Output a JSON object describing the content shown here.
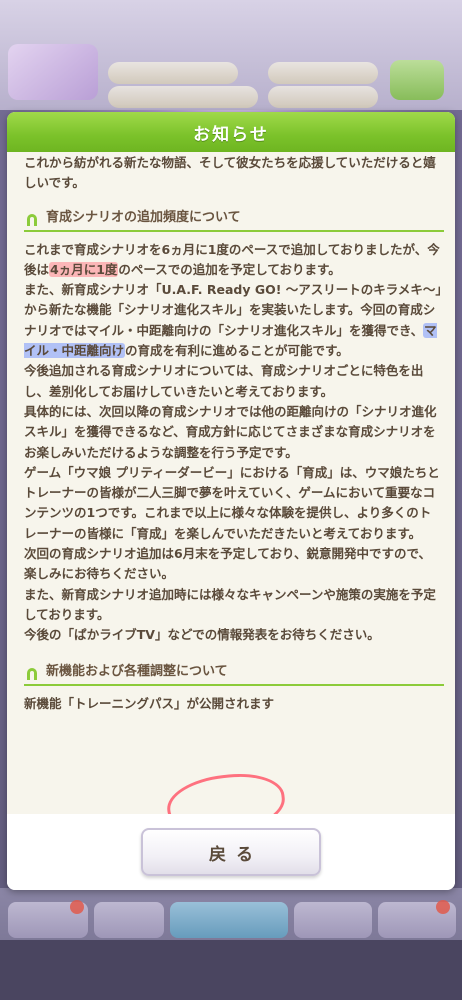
{
  "dialog": {
    "title": "お知らせ",
    "back_label": "戻る"
  },
  "content": {
    "intro": "これから紡がれる新たな物語、そして彼女たちを応援していただけると嬉しいです。",
    "section1": {
      "heading": "育成シナリオの追加頻度について",
      "p1_a": "これまで育成シナリオを6ヵ月に1度のペースで追加しておりましたが、今後は",
      "p1_hl": "4ヵ月に1度",
      "p1_b": "のペースでの追加を予定しております。",
      "p2_a": "また、新育成シナリオ「U.A.F. Ready GO! ～アスリートのキラメキ～」から新たな機能「シナリオ進化スキル」を実装いたします。今回の育成シナリオではマイル・中距離向けの「シナリオ進化スキル」を獲得でき、",
      "p2_hl": "マイル・中距離向け",
      "p2_b": "の育成を有利に進めることが可能です。",
      "p3": "今後追加される育成シナリオについては、育成シナリオごとに特色を出し、差別化してお届けしていきたいと考えております。",
      "p4": "具体的には、次回以降の育成シナリオでは他の距離向けの「シナリオ進化スキル」を獲得できるなど、育成方針に応じてさまざまな育成シナリオをお楽しみいただけるような調整を行う予定です。",
      "p5": "ゲーム「ウマ娘 プリティーダービー」における「育成」は、ウマ娘たちとトレーナーの皆様が二人三脚で夢を叶えていく、ゲームにおいて重要なコンテンツの1つです。これまで以上に様々な体験を提供し、より多くのトレーナーの皆様に「育成」を楽しんでいただきたいと考えております。",
      "p6": "次回の育成シナリオ追加は6月末を予定しており、鋭意開発中ですので、楽しみにお待ちください。",
      "p7": "また、新育成シナリオ追加時には様々なキャンペーンや施策の実施を予定しております。",
      "p8": "今後の「ぱかライブTV」などでの情報発表をお待ちください。"
    },
    "section2": {
      "heading": "新機能および各種調整について",
      "p1": "新機能「トレーニングパス」が公開されます"
    }
  },
  "colors": {
    "header_green": "#7bc22a",
    "body_bg": "#f7f5ec",
    "text_brown": "#5a4a3a",
    "highlight_red": "#ff828c",
    "highlight_blue": "#7896ff"
  }
}
